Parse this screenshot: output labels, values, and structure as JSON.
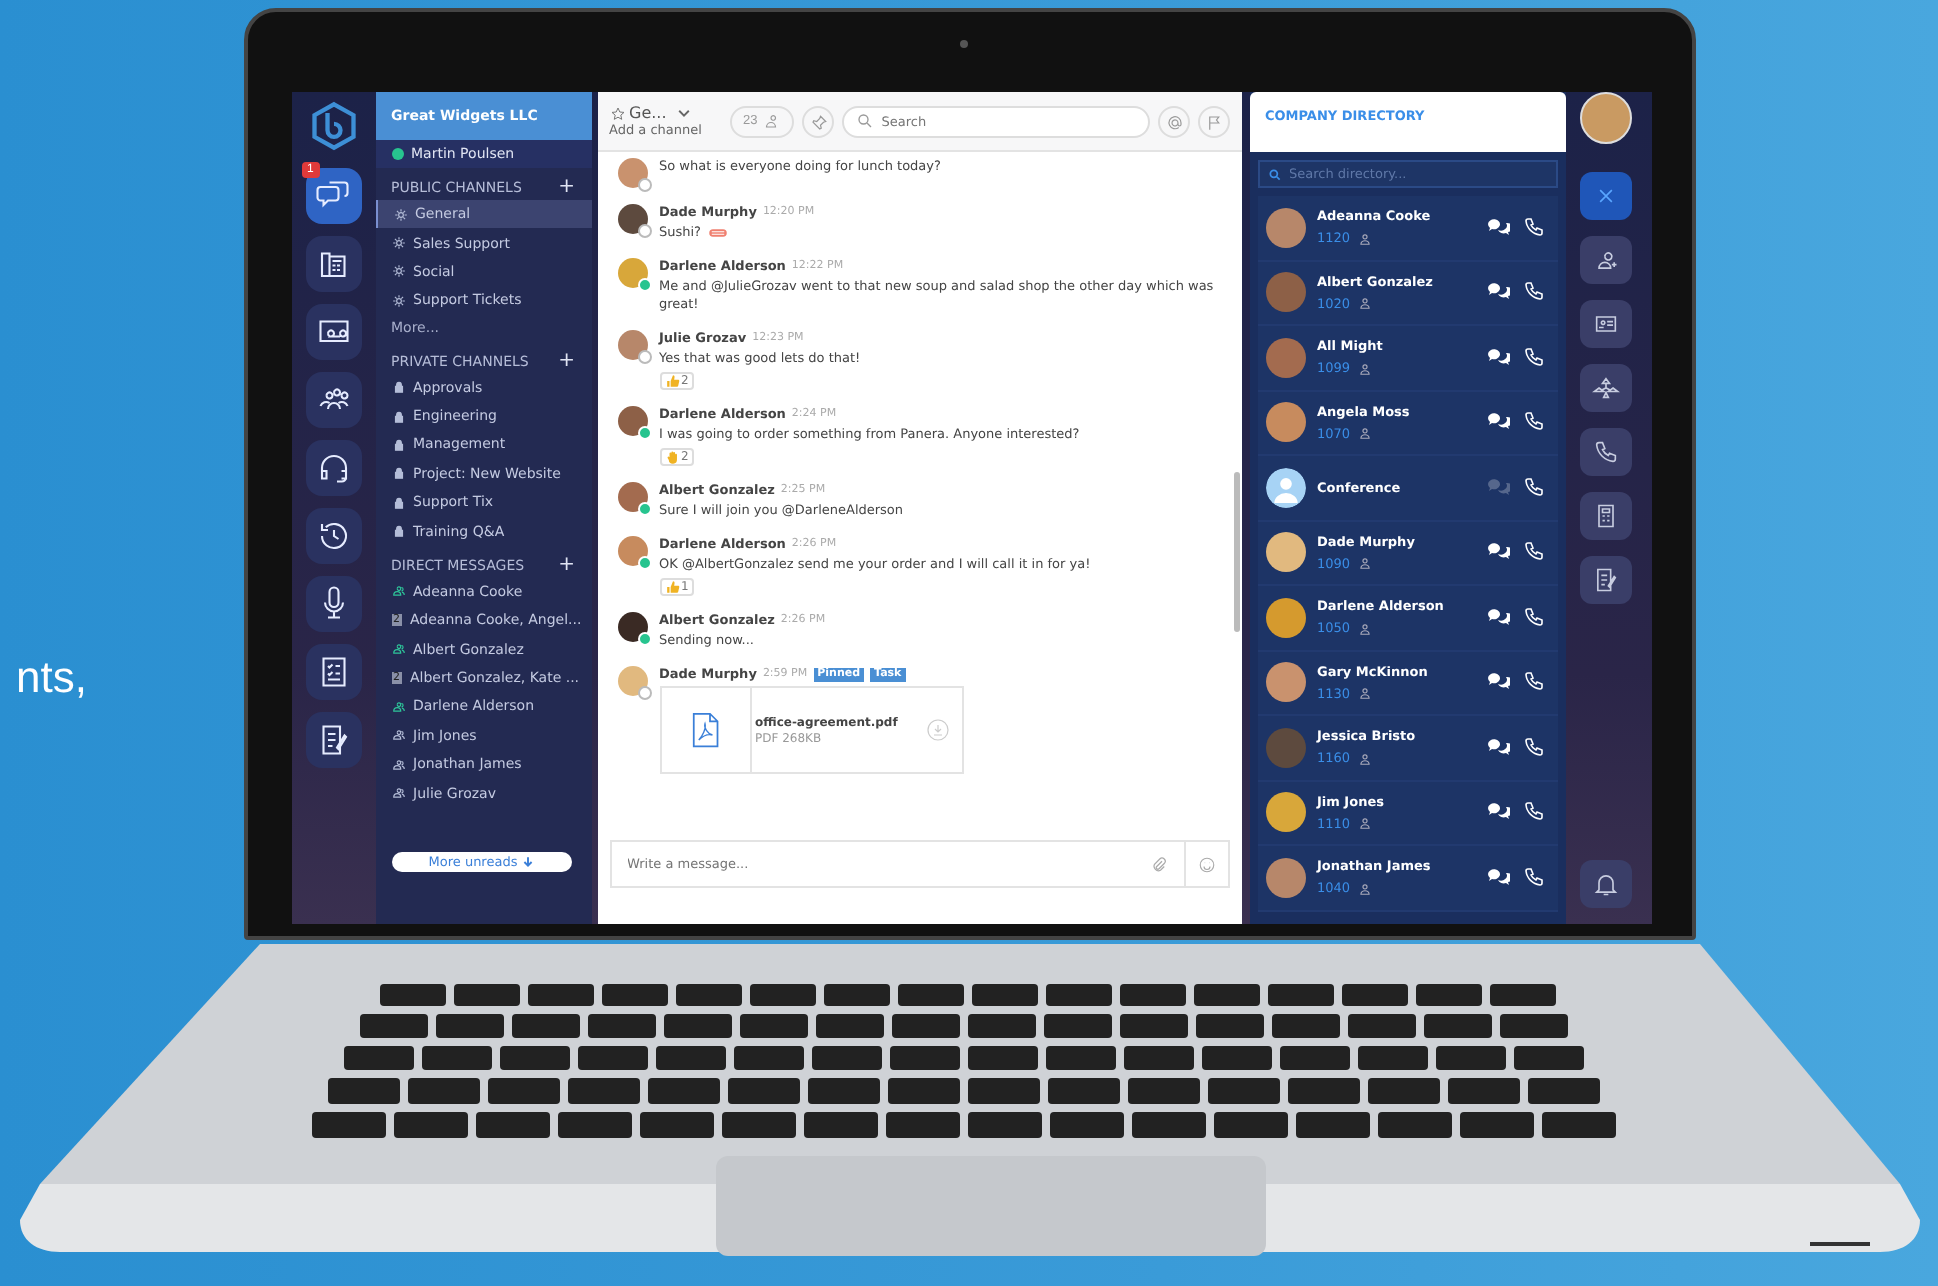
{
  "side_text": "nts,",
  "rail": {
    "badge": "1",
    "items": [
      {
        "kind": "chat",
        "selected": true
      },
      {
        "kind": "desk-phone",
        "selected": false
      },
      {
        "kind": "voicemail",
        "selected": false
      },
      {
        "kind": "group",
        "selected": false
      },
      {
        "kind": "headset",
        "selected": false
      },
      {
        "kind": "history",
        "selected": false
      },
      {
        "kind": "microphone",
        "selected": false
      },
      {
        "kind": "checklist",
        "selected": false
      },
      {
        "kind": "notes",
        "selected": false
      }
    ]
  },
  "workspace": {
    "name": "Great Widgets LLC",
    "user": "Martin Poulsen",
    "user_online": true
  },
  "sections": [
    {
      "title": "PUBLIC CHANNELS",
      "add": "+",
      "more": "More...",
      "items": [
        {
          "kind": "public",
          "label": "General",
          "selected": true
        },
        {
          "kind": "public",
          "label": "Sales Support",
          "selected": false
        },
        {
          "kind": "public",
          "label": "Social",
          "selected": false
        },
        {
          "kind": "public",
          "label": "Support Tickets",
          "selected": false
        }
      ]
    },
    {
      "title": "PRIVATE CHANNELS",
      "add": "+",
      "items": [
        {
          "kind": "private",
          "label": "Approvals",
          "selected": false
        },
        {
          "kind": "private",
          "label": "Engineering",
          "selected": false
        },
        {
          "kind": "private",
          "label": "Management",
          "selected": false
        },
        {
          "kind": "private",
          "label": "Project: New Website",
          "selected": false
        },
        {
          "kind": "private",
          "label": "Support Tix",
          "selected": false
        },
        {
          "kind": "private",
          "label": "Training Q&A",
          "selected": false
        }
      ]
    },
    {
      "title": "DIRECT MESSAGES",
      "add": "+",
      "items": [
        {
          "kind": "online",
          "label": "Adeanna Cooke",
          "selected": false
        },
        {
          "kind": "group",
          "label": "Adeanna Cooke, Angel...",
          "count": "2",
          "selected": false
        },
        {
          "kind": "online",
          "label": "Albert Gonzalez",
          "selected": false
        },
        {
          "kind": "group",
          "label": "Albert Gonzalez, Kate ...",
          "count": "2",
          "selected": false
        },
        {
          "kind": "online",
          "label": "Darlene Alderson",
          "selected": false
        },
        {
          "kind": "offline",
          "label": "Jim Jones",
          "selected": false
        },
        {
          "kind": "offline",
          "label": "Jonathan James",
          "selected": false
        },
        {
          "kind": "offline",
          "label": "Julie Grozav",
          "selected": false
        }
      ]
    }
  ],
  "more_unreads": "More unreads",
  "chat": {
    "channel": "Ge...",
    "subtitle": "Add a channel",
    "members": "23",
    "search_placeholder": "Search",
    "composer_placeholder": "Write a message...",
    "messages": [
      {
        "online": false,
        "text": "So what is everyone doing for lunch today?"
      },
      {
        "author": "Dade Murphy",
        "time": "12:20 PM",
        "online": false,
        "text": "Sushi?",
        "emoji": {
          "kind": "sushi"
        }
      },
      {
        "author": "Darlene Alderson",
        "time": "12:22 PM",
        "online": true,
        "text": "Me and @JulieGrozav went to that new soup and salad shop the other day which was great!"
      },
      {
        "author": "Julie Grozav",
        "time": "12:23 PM",
        "online": false,
        "text": "Yes that was good lets do that!",
        "reaction": {
          "kind": "thumbs-up",
          "count": "2"
        }
      },
      {
        "author": "Darlene Alderson",
        "time": "2:24 PM",
        "online": true,
        "text": "I was going to order something from Panera.  Anyone interested?",
        "reaction": {
          "kind": "raised-hand",
          "count": "2"
        }
      },
      {
        "author": "Albert Gonzalez",
        "time": "2:25 PM",
        "online": true,
        "text": "Sure I will join you @DarleneAlderson"
      },
      {
        "author": "Darlene Alderson",
        "time": "2:26 PM",
        "online": true,
        "text": "OK @AlbertGonzalez send me your order and I will call it in for ya!",
        "reaction": {
          "kind": "thumbs-up",
          "count": "1"
        }
      },
      {
        "author": "Albert Gonzalez",
        "time": "2:26 PM",
        "online": true,
        "text": "Sending now..."
      },
      {
        "author": "Dade Murphy",
        "time": "2:59 PM",
        "online": false,
        "tags": [
          "Pinned",
          "Task"
        ],
        "file": {
          "name": "office-agreement.pdf",
          "size": "PDF 268KB"
        }
      }
    ]
  },
  "directory": {
    "title": "COMPANY DIRECTORY",
    "search_placeholder": "Search directory...",
    "contacts": [
      {
        "kind": "person",
        "name": "Adeanna Cooke",
        "ext": "1120",
        "chat_enabled": true
      },
      {
        "kind": "person",
        "name": "Albert Gonzalez",
        "ext": "1020",
        "chat_enabled": true
      },
      {
        "kind": "person",
        "name": "All Might",
        "ext": "1099",
        "chat_enabled": true
      },
      {
        "kind": "person",
        "name": "Angela Moss",
        "ext": "1070",
        "chat_enabled": true
      },
      {
        "kind": "conference",
        "name": "Conference",
        "chat_enabled": false
      },
      {
        "kind": "person",
        "name": "Dade Murphy",
        "ext": "1090",
        "chat_enabled": true
      },
      {
        "kind": "person",
        "name": "Darlene Alderson",
        "ext": "1050",
        "chat_enabled": true
      },
      {
        "kind": "person",
        "name": "Gary McKinnon",
        "ext": "1130",
        "chat_enabled": true
      },
      {
        "kind": "person",
        "name": "Jessica Bristo",
        "ext": "1160",
        "chat_enabled": true
      },
      {
        "kind": "person",
        "name": "Jim Jones",
        "ext": "1110",
        "chat_enabled": true
      },
      {
        "kind": "person",
        "name": "Jonathan James",
        "ext": "1040",
        "chat_enabled": true
      }
    ]
  },
  "right_rail": {
    "items": [
      {
        "kind": "close",
        "selected": true
      },
      {
        "kind": "add-contact",
        "selected": false
      },
      {
        "kind": "id-card",
        "selected": false
      },
      {
        "kind": "network",
        "selected": false
      },
      {
        "kind": "phone",
        "selected": false
      },
      {
        "kind": "calculator",
        "selected": false
      },
      {
        "kind": "notes",
        "selected": false
      }
    ]
  }
}
